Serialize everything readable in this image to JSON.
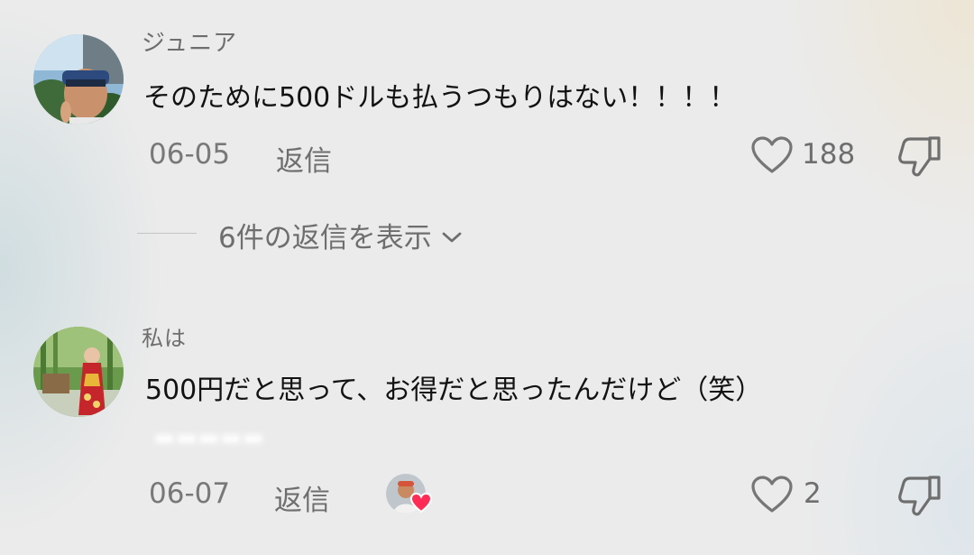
{
  "comments": [
    {
      "username": "ジュニア",
      "text": "そのために500ドルも払うつもりはない！！！！",
      "date": "06-05",
      "reply_label": "返信",
      "likes": "188",
      "view_replies_label": "6件の返信を表示"
    },
    {
      "username": "私は",
      "text": "500円だと思って、お得だと思ったんだけど（笑）",
      "date": "06-07",
      "reply_label": "返信",
      "likes": "2"
    }
  ],
  "colors": {
    "background": "#ebebeb",
    "text_primary": "#121212",
    "text_secondary": "#6e6e6e",
    "heart_badge": "#ff2d55"
  },
  "icons": {
    "like": "heart-outline-icon",
    "dislike": "thumbs-down-icon",
    "expand": "chevron-down-icon",
    "liked_by_creator": "heart-badge-icon"
  }
}
